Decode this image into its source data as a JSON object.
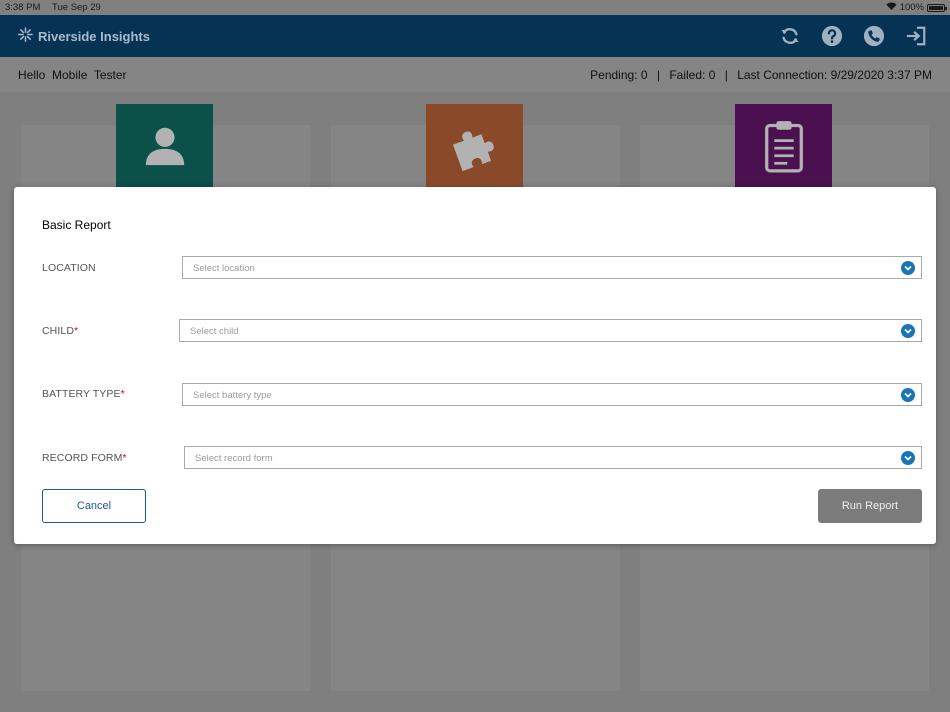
{
  "status_bar": {
    "time": "3:38 PM",
    "date": "Tue Sep 29",
    "battery": "100%"
  },
  "header": {
    "brand": "Riverside Insights",
    "icons": [
      "sync-icon",
      "help-icon",
      "phone-icon",
      "logout-icon"
    ]
  },
  "subheader": {
    "greeting": "Hello  Mobile  Tester",
    "pending": "Pending: 0",
    "failed": "Failed: 0",
    "last_connection": "Last Connection: 9/29/2020 3:37 PM",
    "separator": "|"
  },
  "tiles": [
    {
      "icon": "user-icon",
      "color": "#007466"
    },
    {
      "icon": "puzzle-icon",
      "color": "#a8461a"
    },
    {
      "icon": "clipboard-icon",
      "color": "#5e0064"
    }
  ],
  "modal": {
    "title": "Basic Report",
    "required_marker": "*",
    "fields": [
      {
        "label": "LOCATION",
        "placeholder": "Select location",
        "required": false
      },
      {
        "label": "CHILD",
        "placeholder": "Select child",
        "required": true
      },
      {
        "label": "BATTERY TYPE",
        "placeholder": "Select battery type",
        "required": true
      },
      {
        "label": "RECORD FORM",
        "placeholder": "Select record form",
        "required": true
      }
    ],
    "cancel_label": "Cancel",
    "run_label": "Run Report"
  },
  "colors": {
    "header_bg": "#063254",
    "accent": "#1a74b8",
    "required": "#d0021b",
    "run_button_disabled": "#7b7b7b"
  }
}
